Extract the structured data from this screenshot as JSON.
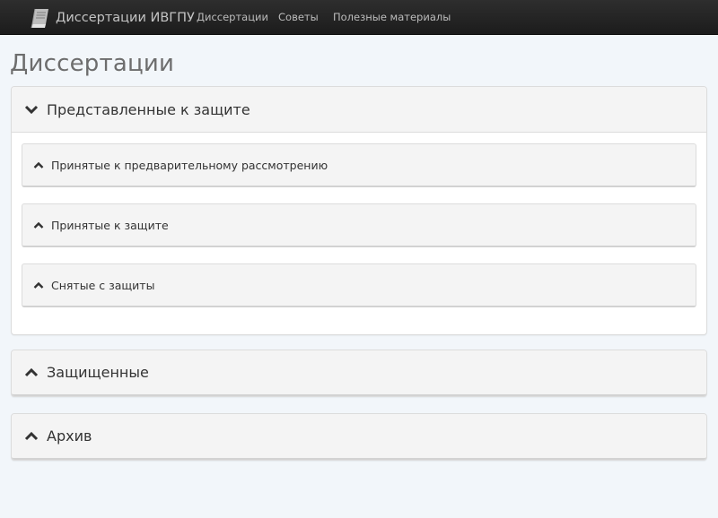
{
  "navbar": {
    "brand": {
      "icon": "book-icon",
      "text": "Диссертации ИВГПУ"
    },
    "links": [
      {
        "label": "Диссертации"
      },
      {
        "label": "Советы"
      },
      {
        "label": "Полезные материалы"
      }
    ]
  },
  "page": {
    "title": "Диссертации"
  },
  "accordion": {
    "presented": {
      "title": "Представленные к защите",
      "state": "expanded",
      "icon": "chevron-down-icon",
      "children": [
        {
          "title": "Принятые к предварительному рассмотрению",
          "icon": "chevron-up-icon"
        },
        {
          "title": "Принятые к защите",
          "icon": "chevron-up-icon"
        },
        {
          "title": "Снятые с защиты",
          "icon": "chevron-up-icon"
        }
      ]
    },
    "defended": {
      "title": "Защищенные",
      "state": "collapsed",
      "icon": "chevron-up-icon"
    },
    "archive": {
      "title": "Архив",
      "state": "collapsed",
      "icon": "chevron-up-icon"
    }
  },
  "colors": {
    "navbar_bg": "#222222",
    "page_bg": "#f2f6fa",
    "panel_heading_bg": "#f4f4f4",
    "title_text": "#6d6d6d"
  }
}
